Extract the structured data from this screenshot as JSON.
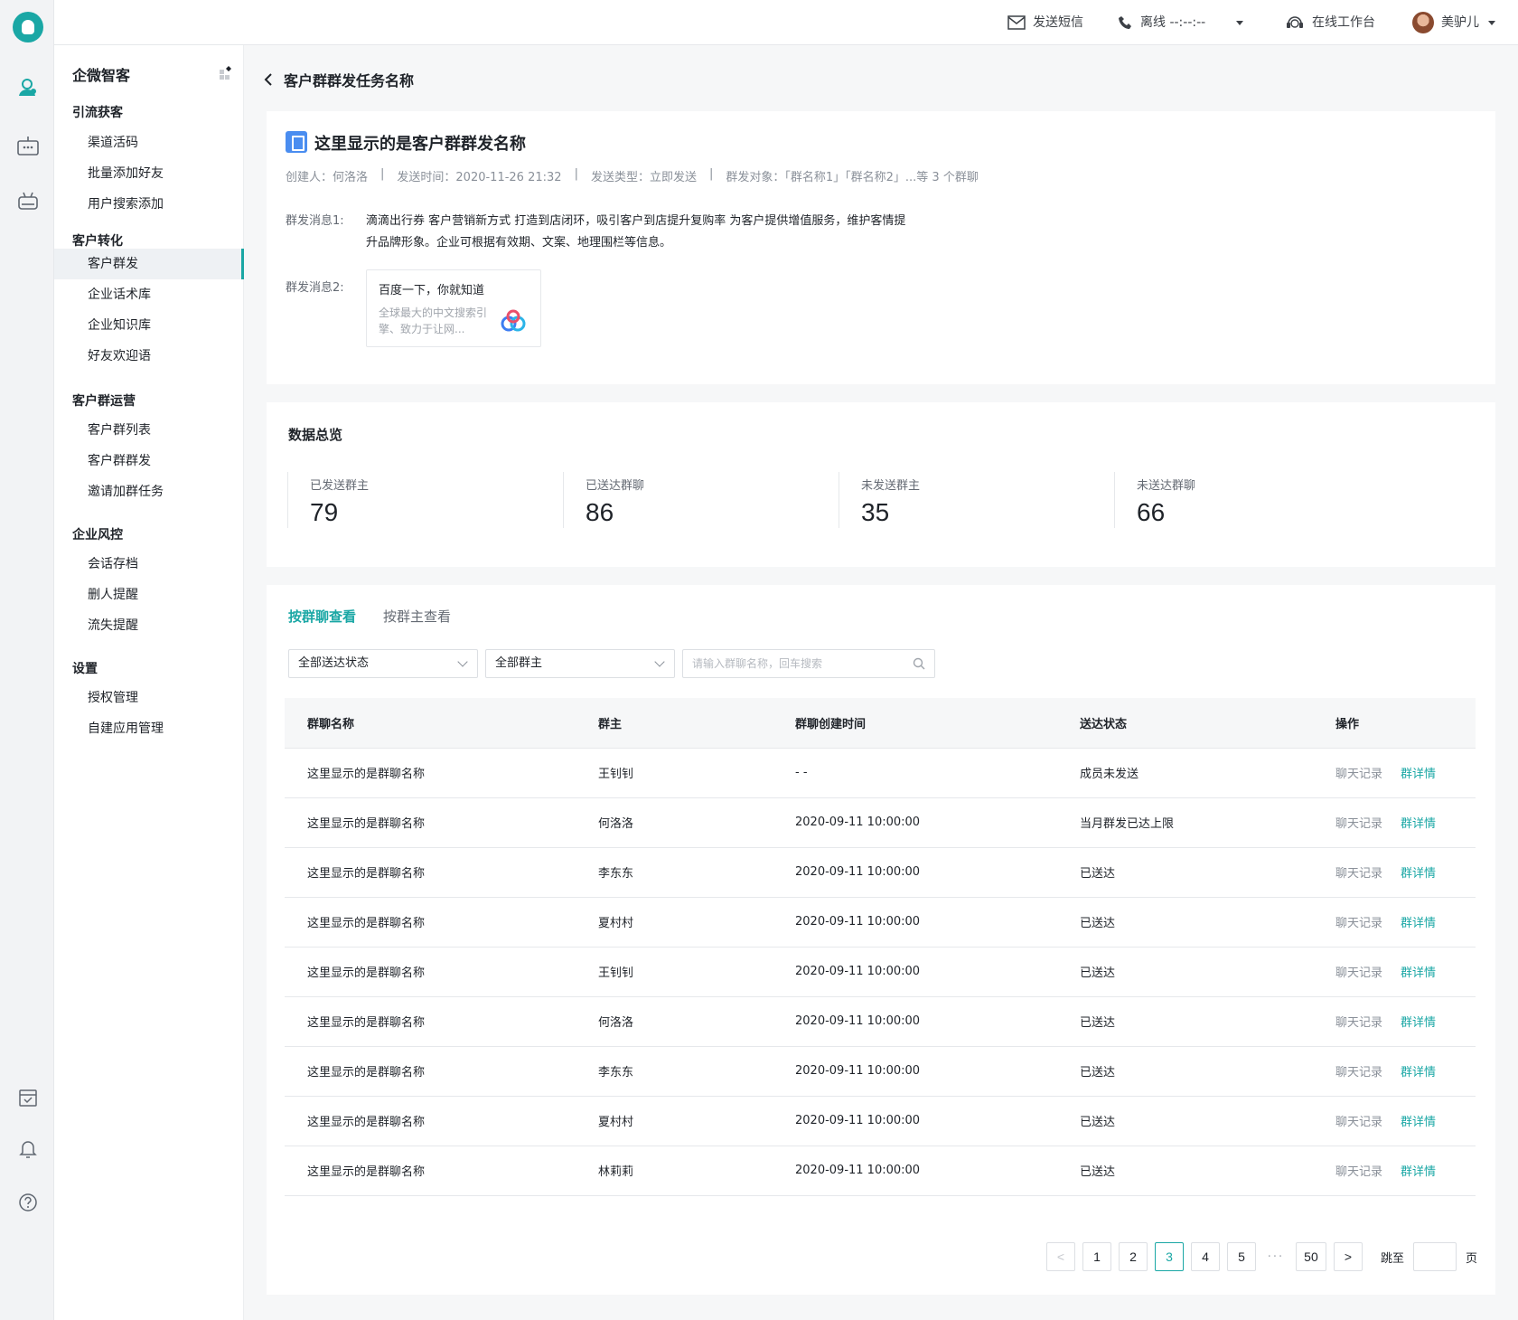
{
  "topbar": {
    "sms": "发送短信",
    "call_status": "离线 --:--:--",
    "workbench": "在线工作台",
    "user_name": "美驴儿"
  },
  "sidebar": {
    "title": "企微智客",
    "groups": [
      {
        "label": "引流获客",
        "items": [
          "渠道活码",
          "批量添加好友",
          "用户搜索添加"
        ]
      },
      {
        "label": "客户转化",
        "items": [
          "客户群发",
          "企业话术库",
          "企业知识库",
          "好友欢迎语"
        ]
      },
      {
        "label": "客户群运营",
        "items": [
          "客户群列表",
          "客户群群发",
          "邀请加群任务"
        ]
      },
      {
        "label": "企业风控",
        "items": [
          "会话存档",
          "删人提醒",
          "流失提醒"
        ]
      },
      {
        "label": "设置",
        "items": [
          "授权管理",
          "自建应用管理"
        ]
      }
    ],
    "active_item": "客户群发"
  },
  "page": {
    "back_title": "客户群群发任务名称"
  },
  "task": {
    "title": "这里显示的是客户群群发名称",
    "creator": "创建人：何洛洛",
    "send_time": "发送时间：2020-11-26 21:32",
    "send_type": "发送类型：立即发送",
    "target": "群发对象：「群名称1」「群名称2」...等 3 个群聊",
    "msg1_label": "群发消息1:",
    "msg1_text": "滴滴出行券 客户营销新方式 打造到店闭环，吸引客户到店提升复购率 为客户提供增值服务，维护客情提升品牌形象。企业可根据有效期、文案、地理围栏等信息。",
    "msg2_label": "群发消息2:",
    "link_title": "百度一下，你就知道",
    "link_desc": "全球最大的中文搜索引擎、致力于让网..."
  },
  "overview": {
    "title": "数据总览",
    "stats": [
      {
        "label": "已发送群主",
        "value": "79"
      },
      {
        "label": "已送达群聊",
        "value": "86"
      },
      {
        "label": "未发送群主",
        "value": "35"
      },
      {
        "label": "未送达群聊",
        "value": "66"
      }
    ]
  },
  "detail": {
    "tabs": [
      "按群聊查看",
      "按群主查看"
    ],
    "filter_status": "全部送达状态",
    "filter_owner": "全部群主",
    "search_placeholder": "请输入群聊名称，回车搜索",
    "columns": [
      "群聊名称",
      "群主",
      "群聊创建时间",
      "送达状态",
      "操作"
    ],
    "op_chat": "聊天记录",
    "op_detail": "群详情",
    "rows": [
      [
        "这里显示的是群聊名称",
        "王钊钊",
        "- -",
        "成员未发送"
      ],
      [
        "这里显示的是群聊名称",
        "何洛洛",
        "2020-09-11 10:00:00",
        "当月群发已达上限"
      ],
      [
        "这里显示的是群聊名称",
        "李东东",
        "2020-09-11 10:00:00",
        "已送达"
      ],
      [
        "这里显示的是群聊名称",
        "夏村村",
        "2020-09-11 10:00:00",
        "已送达"
      ],
      [
        "这里显示的是群聊名称",
        "王钊钊",
        "2020-09-11 10:00:00",
        "已送达"
      ],
      [
        "这里显示的是群聊名称",
        "何洛洛",
        "2020-09-11 10:00:00",
        "已送达"
      ],
      [
        "这里显示的是群聊名称",
        "李东东",
        "2020-09-11 10:00:00",
        "已送达"
      ],
      [
        "这里显示的是群聊名称",
        "夏村村",
        "2020-09-11 10:00:00",
        "已送达"
      ],
      [
        "这里显示的是群聊名称",
        "林莉莉",
        "2020-09-11 10:00:00",
        "已送达"
      ]
    ]
  },
  "pagination": {
    "prev": "<",
    "pages": [
      "1",
      "2",
      "3",
      "4",
      "5"
    ],
    "ellipsis": "···",
    "last": "50",
    "next": ">",
    "current": "3",
    "jump_label": "跳至",
    "page_unit": "页"
  },
  "colors": {
    "accent": "#1aa7a5",
    "task_icon": "#4a8df0"
  }
}
